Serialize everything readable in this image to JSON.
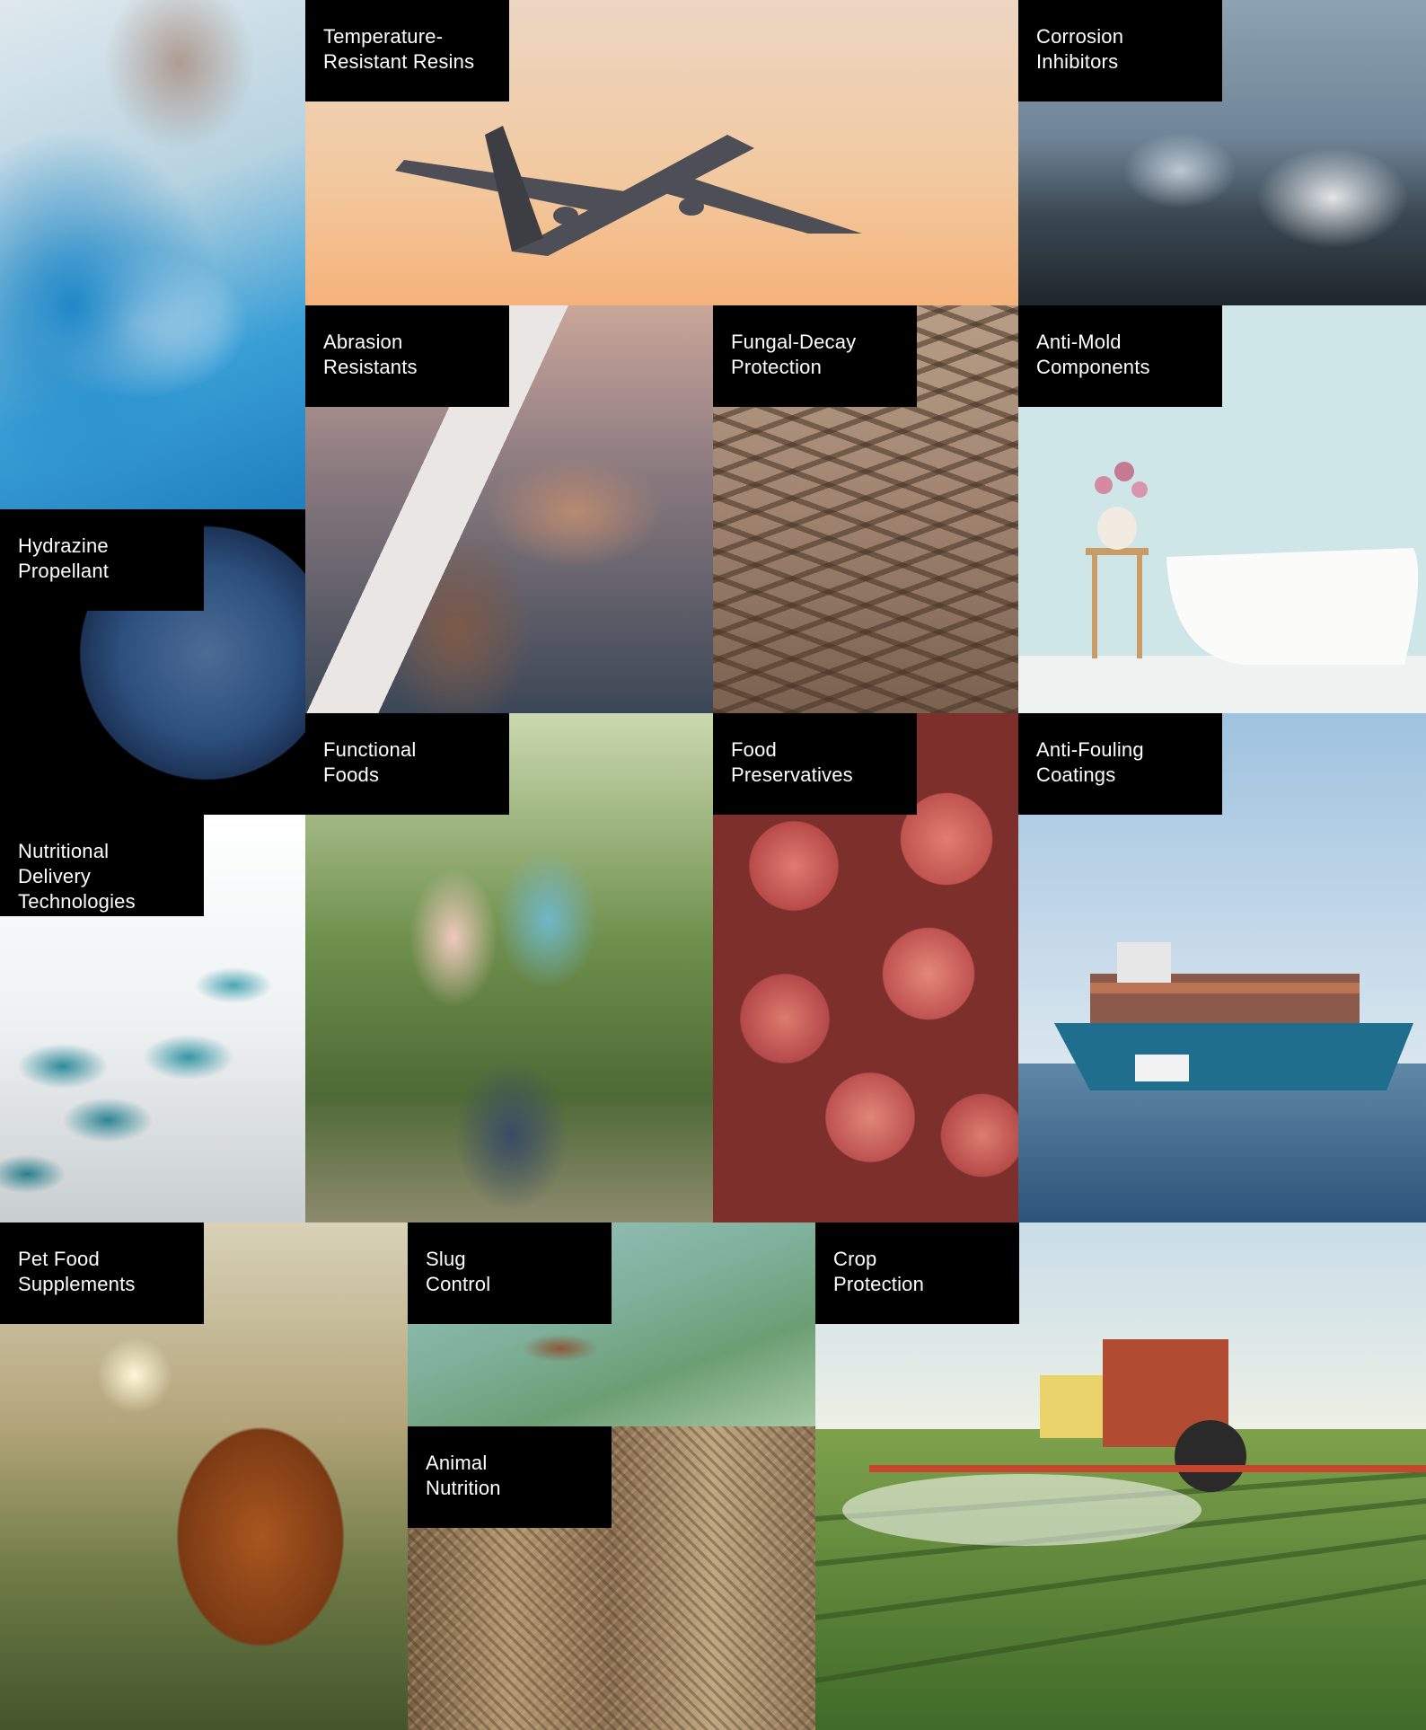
{
  "tiles": [
    {
      "id": "lab-scientist",
      "title": []
    },
    {
      "id": "temperature-resistant-resins",
      "title": [
        "Temperature-",
        "Resistant Resins"
      ]
    },
    {
      "id": "corrosion-inhibitors",
      "title": [
        "Corrosion",
        "Inhibitors"
      ]
    },
    {
      "id": "abrasion-resistants",
      "title": [
        "Abrasion",
        "Resistants"
      ]
    },
    {
      "id": "fungal-decay-protection",
      "title": [
        "Fungal-Decay",
        "Protection"
      ]
    },
    {
      "id": "anti-mold-components",
      "title": [
        "Anti-Mold",
        "Components"
      ]
    },
    {
      "id": "hydrazine-propellant",
      "title": [
        "Hydrazine",
        "Propellant"
      ]
    },
    {
      "id": "functional-foods",
      "title": [
        "Functional",
        "Foods"
      ]
    },
    {
      "id": "food-preservatives",
      "title": [
        "Food",
        "Preservatives"
      ]
    },
    {
      "id": "anti-fouling-coatings",
      "title": [
        "Anti-Fouling",
        "Coatings"
      ]
    },
    {
      "id": "nutritional-delivery-technologies",
      "title": [
        "Nutritional Delivery",
        "Technologies"
      ]
    },
    {
      "id": "pet-food-supplements",
      "title": [
        "Pet Food",
        "Supplements"
      ]
    },
    {
      "id": "slug-control",
      "title": [
        "Slug",
        "Control"
      ]
    },
    {
      "id": "crop-protection",
      "title": [
        "Crop",
        "Protection"
      ]
    },
    {
      "id": "animal-nutrition",
      "title": [
        "Animal",
        "Nutrition"
      ]
    }
  ]
}
